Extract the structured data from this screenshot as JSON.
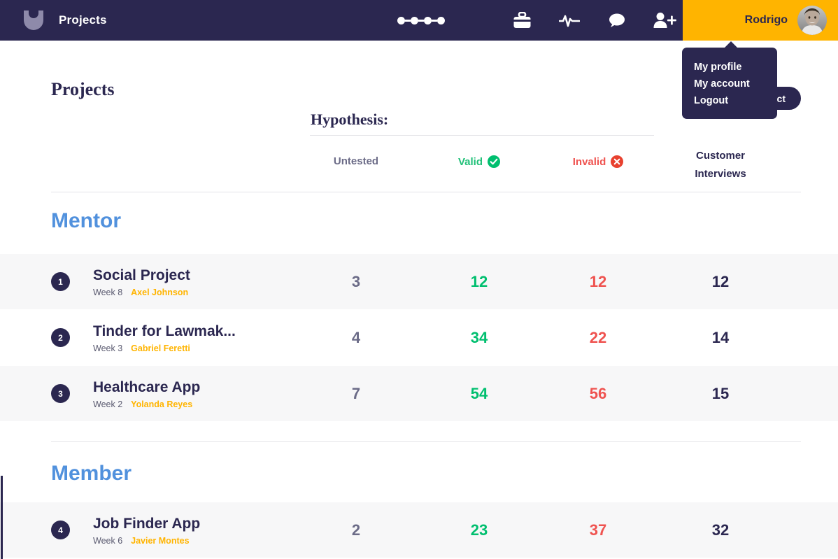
{
  "navbar": {
    "logo_name": "u-logo",
    "title": "Projects",
    "progress_dots_icon": "progress-dots-icon",
    "icons": [
      {
        "name": "briefcase-icon",
        "label": "Briefcase"
      },
      {
        "name": "activity-pulse-icon",
        "label": "Activity"
      },
      {
        "name": "speech-bubble-icon",
        "label": "Messages"
      },
      {
        "name": "add-user-icon",
        "label": "Invite"
      }
    ],
    "user_name": "Rodrigo",
    "accent_yellow": "#ffb400",
    "navy": "#2b2750"
  },
  "user_menu": {
    "items": [
      "My profile",
      "My account",
      "Logout"
    ]
  },
  "page": {
    "title": "Projects",
    "new_project_button": "New project"
  },
  "table": {
    "hypothesis_label": "Hypothesis:",
    "columns": {
      "untested": "Untested",
      "valid": "Valid",
      "invalid": "Invalid",
      "customer_line1": "Customer",
      "customer_line2": "Interviews"
    },
    "colors": {
      "untested": "#6b6b87",
      "valid": "#00bf6f",
      "invalid": "#ef5350",
      "customer": "#2b2750",
      "group": "#5191dd",
      "owner": "#ffb400"
    },
    "groups": [
      {
        "name": "Mentor",
        "rows": [
          {
            "num": "1",
            "name": "Social Project",
            "week": "Week 8",
            "owner": "Axel Johnson",
            "untested": "3",
            "valid": "12",
            "invalid": "12",
            "customer": "12"
          },
          {
            "num": "2",
            "name": "Tinder for Lawmak...",
            "week": "Week 3",
            "owner": "Gabriel Feretti",
            "untested": "4",
            "valid": "34",
            "invalid": "22",
            "customer": "14"
          },
          {
            "num": "3",
            "name": "Healthcare App",
            "week": "Week 2",
            "owner": "Yolanda Reyes",
            "untested": "7",
            "valid": "54",
            "invalid": "56",
            "customer": "15"
          }
        ]
      },
      {
        "name": "Member",
        "rows": [
          {
            "num": "4",
            "name": "Job Finder App",
            "week": "Week 6",
            "owner": "Javier Montes",
            "untested": "2",
            "valid": "23",
            "invalid": "37",
            "customer": "32"
          }
        ]
      }
    ]
  }
}
